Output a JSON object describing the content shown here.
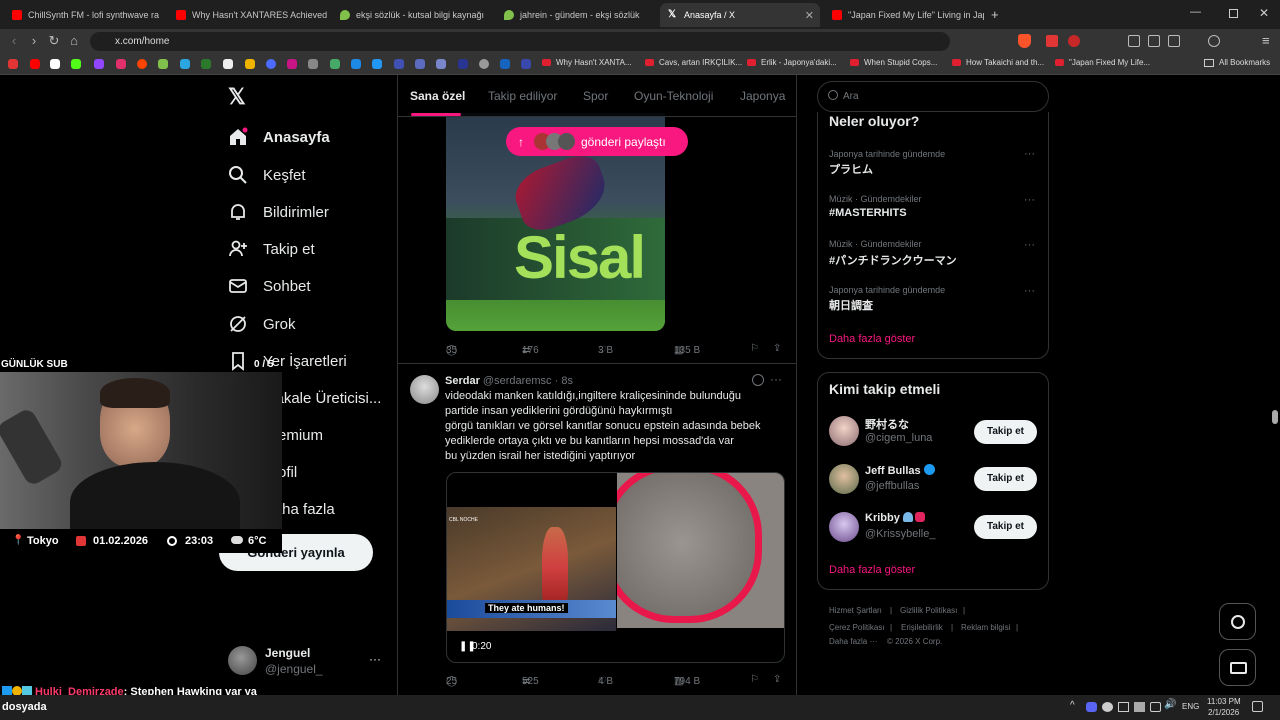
{
  "browser": {
    "tabs": [
      {
        "title": "ChillSynth FM - lofi synthwave ra",
        "color": "#ff0000"
      },
      {
        "title": "Why Hasn't XANTARES Achieved AN",
        "color": "#ff0000"
      },
      {
        "title": "ekşi sözlük - kutsal bilgi kaynağı",
        "color": "#81c14b"
      },
      {
        "title": "jahrein - gündem - ekşi sözlük",
        "color": "#81c14b"
      },
      {
        "title": "Anasayfa / X",
        "color": "#ffffff"
      },
      {
        "title": "\"Japan Fixed My Life\" Living in Japan",
        "color": "#ff0000"
      }
    ],
    "url": "x.com/home",
    "bookmarks": [
      "Why Hasn't XANTA...",
      "Cavs, artan IRKÇILIK...",
      "Erlik - Japonya'daki...",
      "When Stupid Cops...",
      "How Takaichi and th...",
      "\"Japan Fixed My Life..."
    ],
    "all_bookmarks": "All Bookmarks"
  },
  "nav": {
    "items": [
      "Anasayfa",
      "Keşfet",
      "Bildirimler",
      "Takip et",
      "Sohbet",
      "Grok",
      "Yer İşaretleri",
      "Makale Üreticisi...",
      "Premium",
      "Profil",
      "Daha fazla"
    ],
    "post_button": "Gönderi yayınla",
    "account_name": "Jenguel",
    "account_handle": "@jenguel_"
  },
  "feed": {
    "tabs": [
      "Sana özel",
      "Takip ediliyor",
      "Spor",
      "Oyun-Teknoloji",
      "Japonya"
    ],
    "shared_pill": "gönderi paylaştı",
    "post1": {
      "replies": "35",
      "reposts": "176",
      "likes": "3 B",
      "views": "135 B"
    },
    "post2": {
      "name": "Serdar",
      "handle": "@serdaremsc",
      "time": "· 8s",
      "lines": [
        "videodaki manken katıldığı,ingiltere kraliçesininde bulunduğu",
        "partide insan yediklerini gördüğünü haykırmıştı",
        "görgü tanıkları ve görsel kanıtlar sonucu epstein adasında bebek",
        "yediklerde ortaya çıktı ve bu kanıtların hepsi mossad'da var",
        "bu yüzden israil her istediğini yaptırıyor"
      ],
      "video_caption": "They ate humans!",
      "video_time": "0:20",
      "replies": "25",
      "reposts": "525",
      "likes": "4 B",
      "views": "794 B"
    }
  },
  "sidebar": {
    "search_placeholder": "Ara",
    "trends_title": "Neler oluyor?",
    "trends": [
      {
        "category": "Japonya tarihinde gündemde",
        "name": "プラヒム"
      },
      {
        "category": "Müzik · Gündemdekiler",
        "name": "#MASTERHITS"
      },
      {
        "category": "Müzik · Gündemdekiler",
        "name": "#パンチドランクウーマン"
      },
      {
        "category": "Japonya tarihinde gündemde",
        "name": "朝日調査"
      }
    ],
    "show_more": "Daha fazla göster",
    "who_title": "Kimi takip etmeli",
    "who": [
      {
        "name": "野村るな",
        "handle": "@cigem_luna"
      },
      {
        "name": "Jeff Bullas",
        "handle": "@jeffbullas"
      },
      {
        "name": "Kribby",
        "handle": "@Krissybelle_"
      }
    ],
    "follow_label": "Takip et",
    "footer": [
      "Hizmet Şartları",
      "Gizlilik Politikası",
      "Çerez Politikası",
      "Erişilebilirlik",
      "Reklam bilgisi",
      "Daha fazla ···",
      "© 2026 X Corp."
    ]
  },
  "overlay": {
    "sub_label": "GÜNLÜK SUB",
    "sub_count": "0 / 5",
    "location": "Tokyo",
    "date": "01.02.2026",
    "time": "23:03",
    "temp": "6°C",
    "chat_user": "Hulki_Demirzade",
    "chat_text": ": Stephen Hawking var ya",
    "chat_text2": "dosyada"
  },
  "taskbar": {
    "lang": "ENG",
    "clock": "11:03 PM",
    "date": "2/1/2026"
  }
}
